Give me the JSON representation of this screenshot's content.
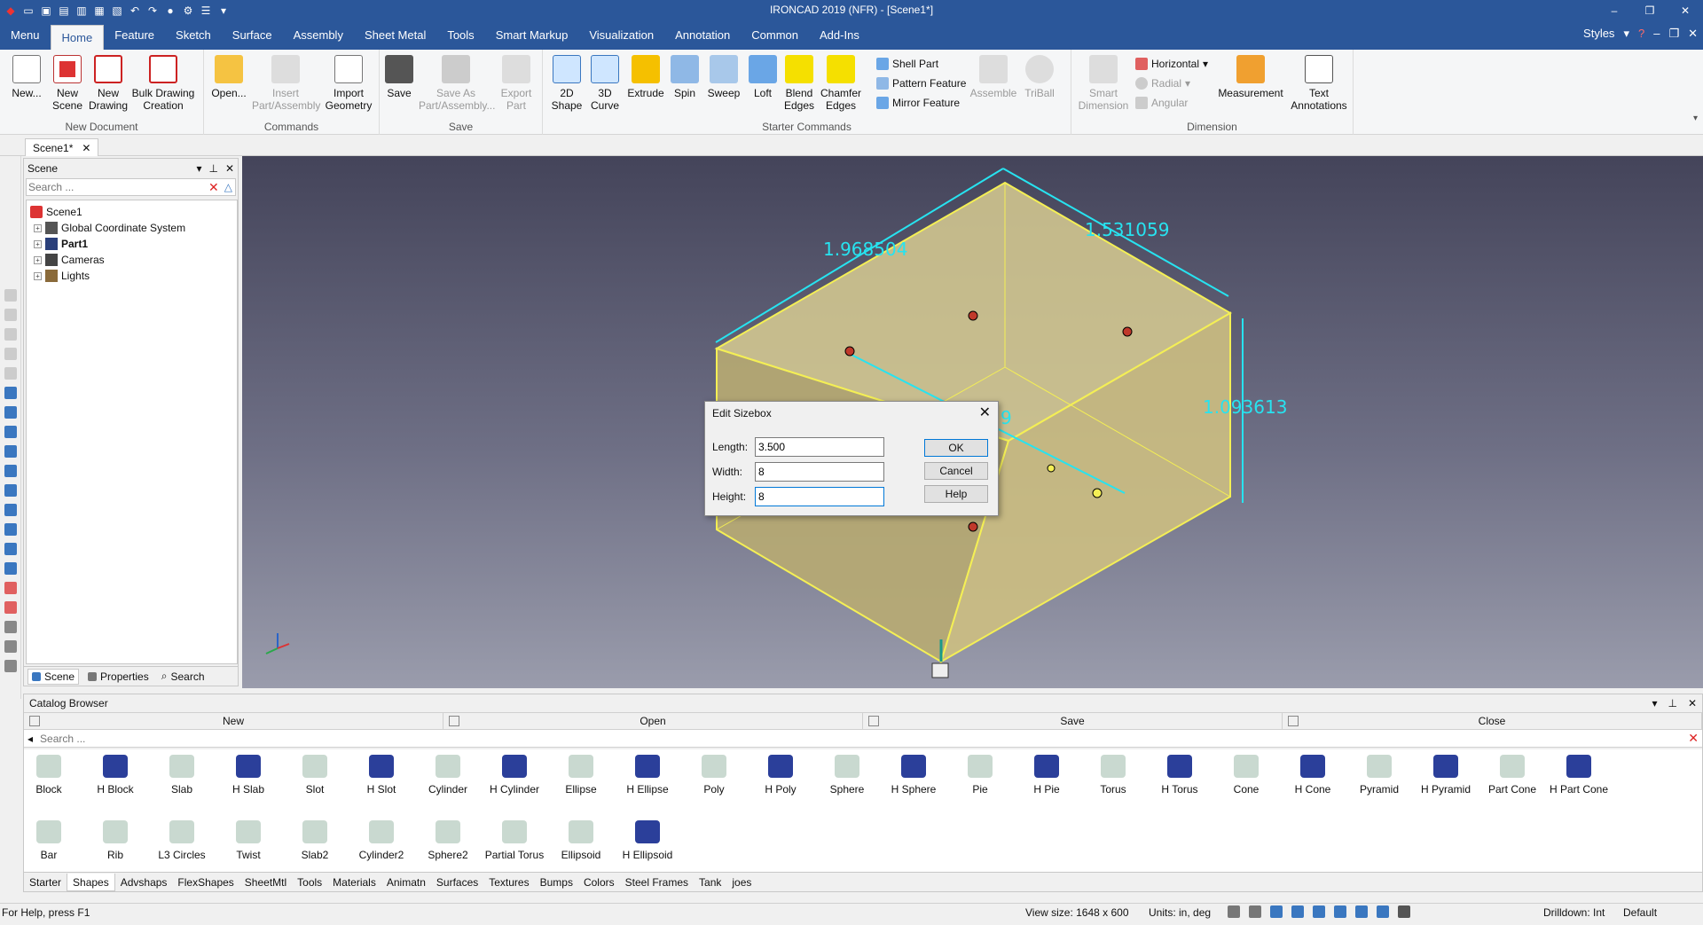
{
  "window": {
    "title": "IRONCAD 2019 (NFR) - [Scene1*]",
    "controls": [
      "–",
      "❐",
      "✕"
    ]
  },
  "menu_tabs": [
    "Menu",
    "Home",
    "Feature",
    "Sketch",
    "Surface",
    "Assembly",
    "Sheet Metal",
    "Tools",
    "Smart Markup",
    "Visualization",
    "Annotation",
    "Common",
    "Add-Ins"
  ],
  "menu_active": "Home",
  "menu_right": {
    "styles": "Styles"
  },
  "ribbon": {
    "new_document": {
      "label": "New Document",
      "new": "New...",
      "new_scene": "New Scene",
      "new_drawing": "New Drawing",
      "bulk": "Bulk Drawing Creation"
    },
    "commands": {
      "label": "Commands",
      "open": "Open...",
      "insert": "Insert Part/Assembly",
      "import": "Import Geometry"
    },
    "save": {
      "label": "Save",
      "save": "Save",
      "save_as": "Save As Part/Assembly...",
      "export": "Export Part"
    },
    "starter": {
      "label": "Starter Commands",
      "shape2d": "2D Shape",
      "curve3d": "3D Curve",
      "extrude": "Extrude",
      "spin": "Spin",
      "sweep": "Sweep",
      "loft": "Loft",
      "blend": "Blend Edges",
      "chamfer": "Chamfer Edges",
      "shell": "Shell Part",
      "pattern": "Pattern Feature",
      "mirror": "Mirror Feature",
      "assemble": "Assemble",
      "triball": "TriBall"
    },
    "dimension": {
      "label": "Dimension",
      "smart": "Smart Dimension",
      "horizontal": "Horizontal",
      "radial": "Radial",
      "angular": "Angular",
      "measurement": "Measurement",
      "text": "Text Annotations"
    }
  },
  "doc_tab": "Scene1*",
  "scene_panel": {
    "title": "Scene",
    "search_placeholder": "Search ...",
    "tree": [
      {
        "label": "Scene1",
        "bold": false
      },
      {
        "label": "Global Coordinate System",
        "bold": false
      },
      {
        "label": "Part1",
        "bold": true
      },
      {
        "label": "Cameras",
        "bold": false
      },
      {
        "label": "Lights",
        "bold": false
      }
    ],
    "footer_tabs": [
      "Scene",
      "Properties",
      "Search"
    ]
  },
  "viewport": {
    "dims": [
      "1.968504",
      "1.531059",
      "1.093613"
    ],
    "hidden_dim": "9"
  },
  "dialog": {
    "title": "Edit Sizebox",
    "length_label": "Length:",
    "length_value": "3.500",
    "width_label": "Width:",
    "width_value": "8",
    "height_label": "Height:",
    "height_value": "8",
    "ok": "OK",
    "cancel": "Cancel",
    "help": "Help"
  },
  "catalog": {
    "title": "Catalog Browser",
    "actions": [
      "New",
      "Open",
      "Save",
      "Close"
    ],
    "search_placeholder": "Search ...",
    "row1": [
      "Block",
      "H Block",
      "Slab",
      "H Slab",
      "Slot",
      "H Slot",
      "Cylinder",
      "H Cylinder",
      "Ellipse",
      "H Ellipse",
      "Poly",
      "H Poly",
      "Sphere",
      "H Sphere",
      "Pie",
      "H Pie",
      "Torus",
      "H Torus",
      "Cone",
      "H Cone",
      "Pyramid",
      "H Pyramid",
      "Part Cone",
      "H Part Cone"
    ],
    "row2": [
      "Bar",
      "Rib",
      "L3 Circles",
      "Twist",
      "Slab2",
      "Cylinder2",
      "Sphere2",
      "Partial Torus",
      "Ellipsoid",
      "H Ellipsoid"
    ],
    "tabs": [
      "Starter",
      "Shapes",
      "Advshaps",
      "FlexShapes",
      "SheetMtl",
      "Tools",
      "Materials",
      "Animatn",
      "Surfaces",
      "Textures",
      "Bumps",
      "Colors",
      "Steel Frames",
      "Tank",
      "joes"
    ],
    "active_tab": "Shapes"
  },
  "status": {
    "help": "For Help, press F1",
    "view_size": "View size: 1648 x 600",
    "units": "Units: in, deg",
    "drilldown": "Drilldown: Int",
    "default": "Default"
  },
  "colors": {
    "accent": "#2b579a",
    "dimension": "#27e3f0",
    "part_fill": "#e3d796",
    "part_edge": "#f4ef55"
  }
}
